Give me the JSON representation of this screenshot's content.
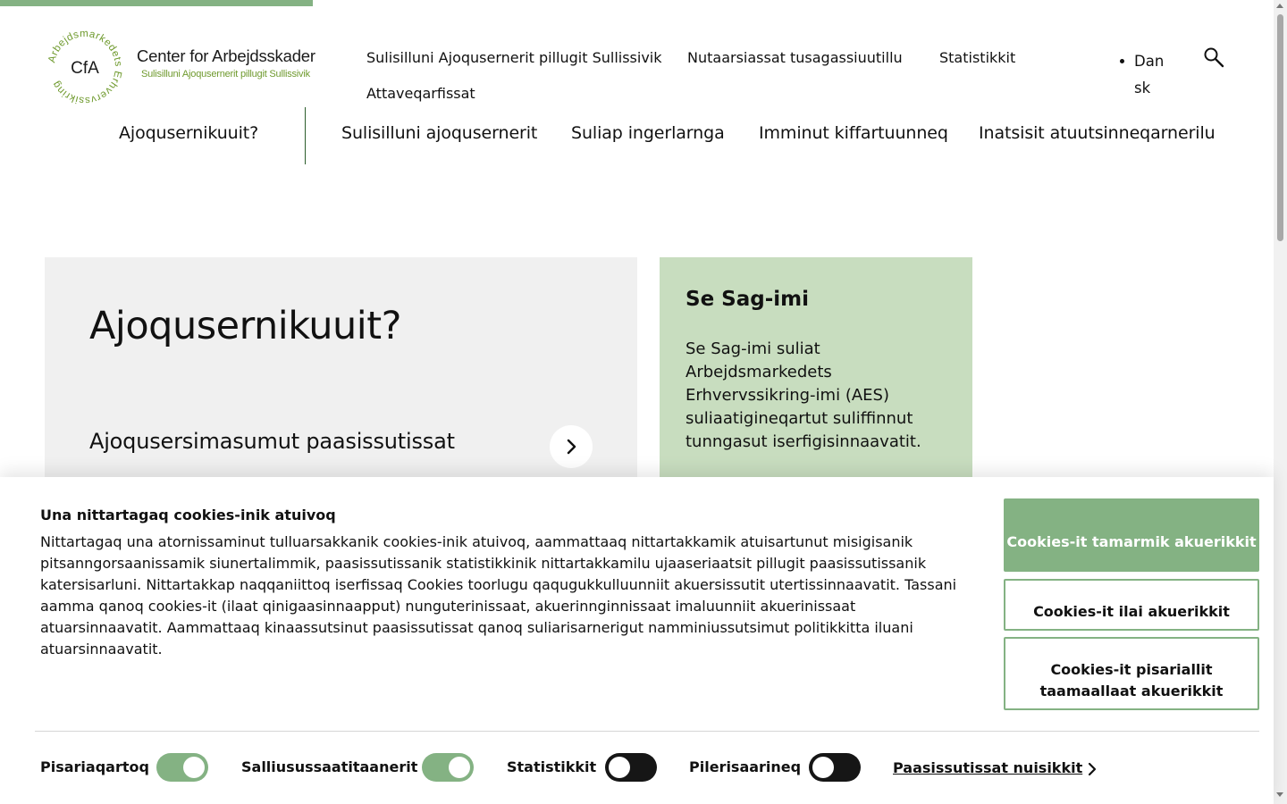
{
  "logo": {
    "ring_text": "Arbejdsmarkedets Erhvervssikring",
    "mark": "CfA",
    "name": "Center for Arbejdsskader",
    "subtitle": "Sulisilluni Ajoqusernerit pillugit Sullissivik"
  },
  "utility_nav": [
    {
      "label": "Sulisilluni Ajoqusernerit pillugit Sullissivik"
    },
    {
      "label": "Nutaarsiassat tusagassiuutillu"
    },
    {
      "label": "Statistikkit"
    },
    {
      "label": "Attaveqarfissat"
    }
  ],
  "language": {
    "label": "Dan sk"
  },
  "search": {
    "icon": "search-icon"
  },
  "main_nav": [
    {
      "label": "Ajoqusernikuuit?"
    },
    {
      "label": "Sulisilluni ajoqusernerit"
    },
    {
      "label": "Suliap ingerlarnga"
    },
    {
      "label": "Imminut kiffartuunneq"
    },
    {
      "label": "Inatsisit atuutsinneqarnerilu"
    }
  ],
  "hero": {
    "title": "Ajoqusernikuuit?",
    "link": "Ajoqusersimasumut paasissutissat",
    "arrow_icon": "chevron-right-icon"
  },
  "side_card": {
    "title": "Se Sag-imi",
    "text": "Se Sag-imi suliat Arbejdsmarkedets Erhvervssikring-imi (AES) suliaatigineqartut suliffinnut tunngasut iserfigisinnaavatit."
  },
  "cookie_banner": {
    "title": "Una nittartagaq cookies-inik atuivoq",
    "text": "Nittartagaq una atornissaminut tulluarsakkanik cookies-inik atuivoq, aammattaaq nittartakkamik atuisartunut misigisanik pitsanngorsaanissamik siunertalimmik, paasissutissanik statistikkinik nittartakkamilu ujaaseriaatsit pillugit paasissutissanik katersisarluni. Nittartakkap naqqaniittoq iserfissaq Cookies toorlugu qaqugukkulluunniit akuersissutit utertissinnaavatit. Tassani aamma qanoq cookies-it (ilaat qinigaasinnaapput) nunguterinissaat, akuerinnginnissaat imaluunniit akuerinissaat atuarsinnaavatit. Aammattaaq kinaassutsinut paasissutissat qanoq suliarisarnerigut namminiussutsimut politikkitta iluani atuarsinnaavatit.",
    "buttons": {
      "accept_all": "Cookies-it tamarmik akuerikkit",
      "reject": "Cookies-it ilai akuerikkit",
      "accept_selected": "Cookies-it pisariallit taamaallaat akuerikkit"
    },
    "toggles": [
      {
        "label": "Pisariaqartoq",
        "state": "on"
      },
      {
        "label": "Salliusussaatitaanerit",
        "state": "on"
      },
      {
        "label": "Statistikkit",
        "state": "off"
      },
      {
        "label": "Pilerisaarineq",
        "state": "off"
      }
    ],
    "details_link": "Paasissutissat nuisikkit"
  },
  "colors": {
    "accent": "#84b283",
    "card_green": "#c8ddbf",
    "card_grey": "#f0f0f0",
    "nav_divider": "#2c5d2c",
    "logo_green": "#6f9a2e",
    "toggle_off": "#161616"
  }
}
